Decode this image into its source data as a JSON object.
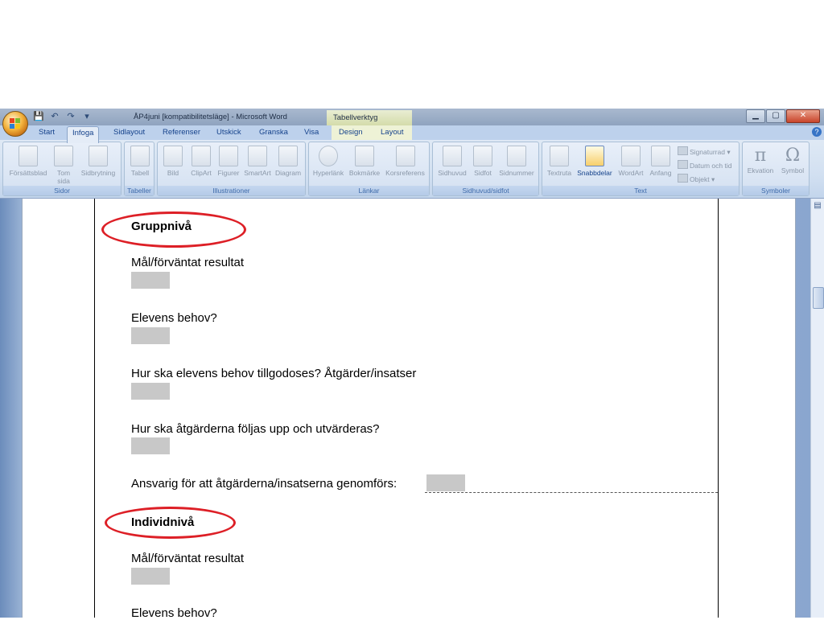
{
  "window": {
    "title": "ÅP4juni [kompatibilitetsläge] - Microsoft Word",
    "contextual_tab_title": "Tabellverktyg",
    "controls": {
      "minimize": "▁",
      "maximize": "▢",
      "close": "✕"
    }
  },
  "quick_access": [
    "save-icon",
    "undo-icon",
    "redo-icon",
    "customize-icon"
  ],
  "tabs": [
    {
      "label": "Start"
    },
    {
      "label": "Infoga",
      "active": true
    },
    {
      "label": "Sidlayout"
    },
    {
      "label": "Referenser"
    },
    {
      "label": "Utskick"
    },
    {
      "label": "Granska"
    },
    {
      "label": "Visa"
    },
    {
      "label": "Design"
    },
    {
      "label": "Layout"
    }
  ],
  "ribbon": {
    "groups": [
      {
        "label": "Sidor",
        "buttons": [
          "Försättsblad",
          "Tom\nsida",
          "Sidbrytning"
        ]
      },
      {
        "label": "Tabeller",
        "buttons": [
          "Tabell"
        ]
      },
      {
        "label": "Illustrationer",
        "buttons": [
          "Bild",
          "ClipArt",
          "Figurer",
          "SmartArt",
          "Diagram"
        ]
      },
      {
        "label": "Länkar",
        "buttons": [
          "Hyperlänk",
          "Bokmärke",
          "Korsreferens"
        ]
      },
      {
        "label": "Sidhuvud/sidfot",
        "buttons": [
          "Sidhuvud",
          "Sidfot",
          "Sidnummer"
        ]
      },
      {
        "label": "Text",
        "buttons": [
          "Textruta",
          "Snabbdelar",
          "WordArt",
          "Anfang"
        ],
        "small_buttons": [
          "Signaturrad",
          "Datum och tid",
          "Objekt"
        ]
      },
      {
        "label": "Symboler",
        "buttons": [
          "Ekvation",
          "Symbol"
        ]
      }
    ]
  },
  "document": {
    "heading_group": "Gruppnivå",
    "q_goal": "Mål/förväntat resultat",
    "q_needs": "Elevens behov?",
    "q_how": "Hur ska elevens behov tillgodoses? Åtgärder/insatser",
    "q_followup": "Hur ska åtgärderna följas upp och utvärderas?",
    "q_responsible": "Ansvarig för att åtgärderna/insatserna genomförs:",
    "heading_individual": "Individnivå",
    "q_goal_2": "Mål/förväntat resultat",
    "q_needs_2": "Elevens behov?"
  },
  "colors": {
    "annotation_oval": "#dd1f26",
    "form_field": "#c8c8c8"
  }
}
